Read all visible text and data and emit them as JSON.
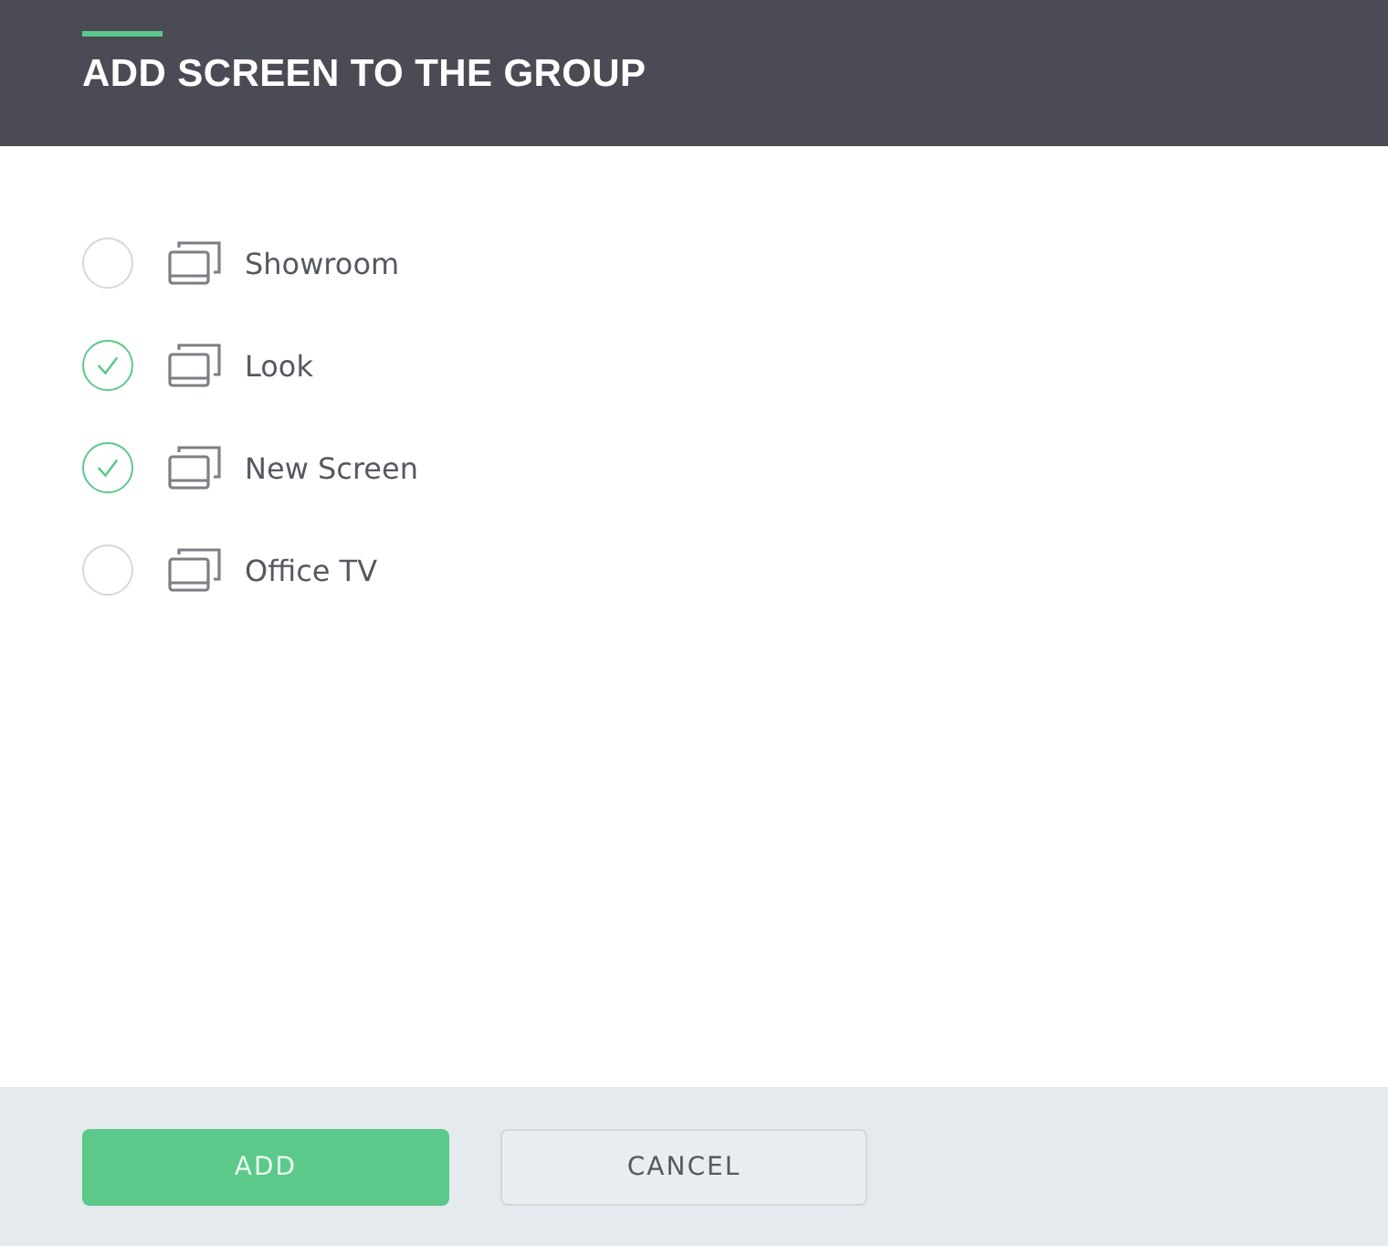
{
  "dialog": {
    "title": "ADD SCREEN TO THE GROUP"
  },
  "screens": [
    {
      "name": "Showroom",
      "checked": false
    },
    {
      "name": "Look",
      "checked": true
    },
    {
      "name": "New Screen",
      "checked": true
    },
    {
      "name": "Office TV",
      "checked": false
    }
  ],
  "buttons": [
    {
      "label": "ADD",
      "kind": "primary"
    },
    {
      "label": "CANCEL",
      "kind": "secondary"
    }
  ]
}
